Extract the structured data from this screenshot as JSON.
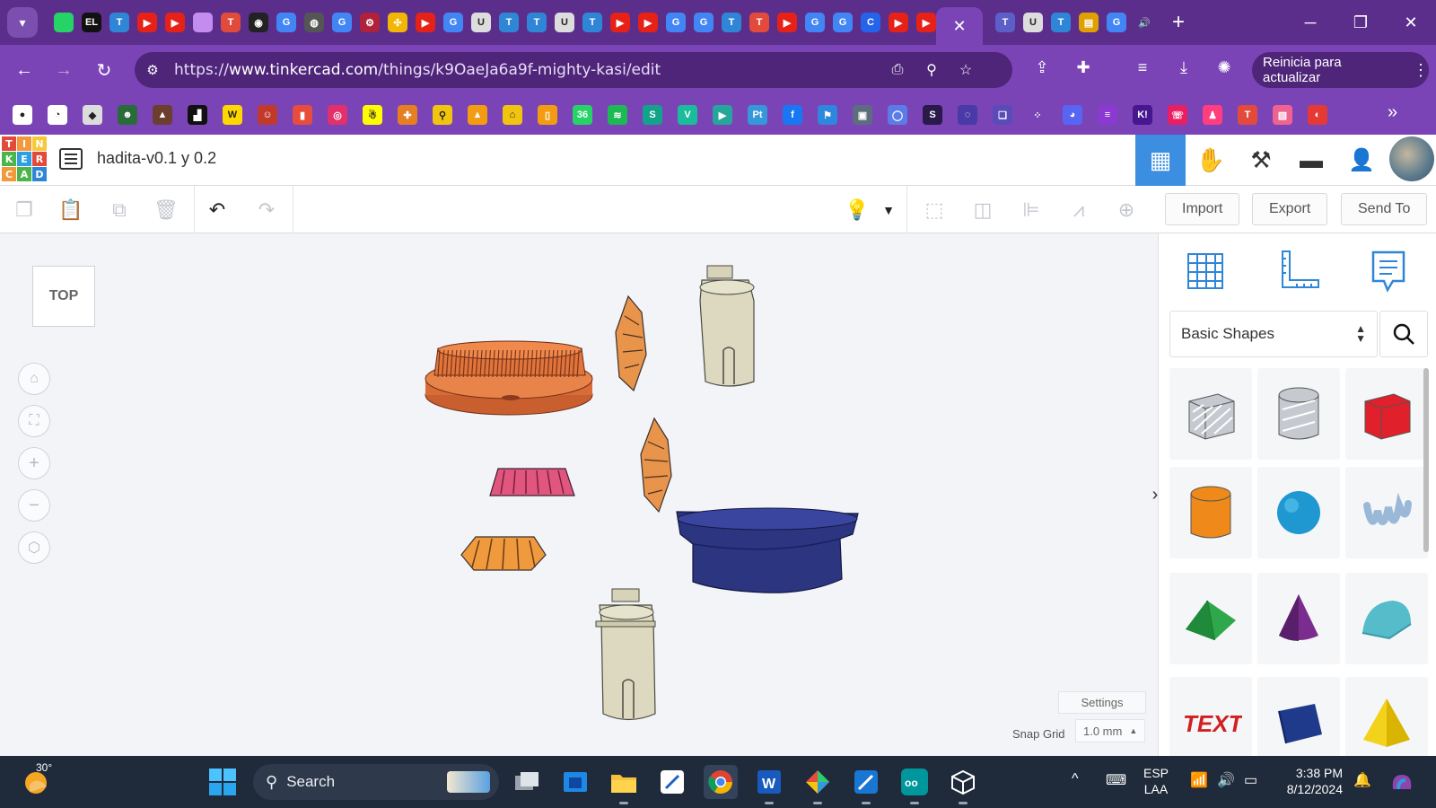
{
  "browser": {
    "tab_strip": {
      "badge_count": "36",
      "close_glyph": "✕",
      "new_tab_glyph": "+",
      "tab_favicons": [
        {
          "icon": "whatsapp-icon",
          "color": "#25d366",
          "text": ""
        },
        {
          "icon": "el-icon",
          "color": "#111111",
          "text": "EL"
        },
        {
          "icon": "teams-t-icon",
          "color": "#2f86d6",
          "text": "T"
        },
        {
          "icon": "youtube-icon",
          "color": "#e62117",
          "text": "▶"
        },
        {
          "icon": "youtube-icon",
          "color": "#e62117",
          "text": "▶"
        },
        {
          "icon": "lilac-square-icon",
          "color": "#c58cf0",
          "text": ""
        },
        {
          "icon": "tinkercad-icon",
          "color": "#e24a3b",
          "text": "T"
        },
        {
          "icon": "github-icon",
          "color": "#222222",
          "text": "◉"
        },
        {
          "icon": "google-icon",
          "color": "#4285f4",
          "text": "G"
        },
        {
          "icon": "globe-icon",
          "color": "#555555",
          "text": "◍"
        },
        {
          "icon": "google-icon",
          "color": "#4285f4",
          "text": "G"
        },
        {
          "icon": "gear-red-icon",
          "color": "#b0213a",
          "text": "⚙"
        },
        {
          "icon": "pinwheel-icon",
          "color": "#f2b705",
          "text": "✣"
        },
        {
          "icon": "youtube-icon",
          "color": "#e62117",
          "text": "▶"
        },
        {
          "icon": "google-icon",
          "color": "#4285f4",
          "text": "G"
        },
        {
          "icon": "u-icon",
          "color": "#dddddd",
          "text": "U"
        },
        {
          "icon": "teams-t-icon",
          "color": "#2f86d6",
          "text": "T"
        },
        {
          "icon": "teams-t-icon",
          "color": "#2f86d6",
          "text": "T"
        },
        {
          "icon": "u-icon",
          "color": "#dddddd",
          "text": "U"
        },
        {
          "icon": "teams-t-icon",
          "color": "#2f86d6",
          "text": "T"
        },
        {
          "icon": "youtube-icon",
          "color": "#e62117",
          "text": "▶"
        },
        {
          "icon": "youtube-icon",
          "color": "#e62117",
          "text": "▶"
        },
        {
          "icon": "google-icon",
          "color": "#4285f4",
          "text": "G"
        },
        {
          "icon": "google-icon",
          "color": "#4285f4",
          "text": "G"
        },
        {
          "icon": "teams-t-icon",
          "color": "#2f86d6",
          "text": "T"
        },
        {
          "icon": "tinkercad-icon",
          "color": "#e24a3b",
          "text": "T"
        },
        {
          "icon": "youtube-icon",
          "color": "#e62117",
          "text": "▶"
        },
        {
          "icon": "google-icon",
          "color": "#4285f4",
          "text": "G"
        },
        {
          "icon": "google-icon",
          "color": "#4285f4",
          "text": "G"
        },
        {
          "icon": "copilot-c-icon",
          "color": "#2563eb",
          "text": "C"
        },
        {
          "icon": "youtube-icon",
          "color": "#e62117",
          "text": "▶"
        },
        {
          "icon": "youtube-icon",
          "color": "#e62117",
          "text": "▶"
        }
      ],
      "tab_favicons_after_active": [
        {
          "icon": "teams-icon",
          "color": "#5b5fc7",
          "text": "T"
        },
        {
          "icon": "u-icon",
          "color": "#dddddd",
          "text": "U"
        },
        {
          "icon": "teams-t-icon",
          "color": "#2f86d6",
          "text": "T"
        },
        {
          "icon": "tv-icon",
          "color": "#e0a100",
          "text": "▤"
        },
        {
          "icon": "google-icon",
          "color": "#4285f4",
          "text": "G"
        },
        {
          "icon": "speaker-icon",
          "color": "#5b2e8c",
          "text": "🔊"
        }
      ]
    },
    "url": {
      "prefix": "https://",
      "host": "www.tinkercad.com",
      "path": "/things/k9OaeJa6a9f-mighty-kasi/edit"
    },
    "relaunch_label": "Reinicia para actualizar",
    "bookmarks": [
      {
        "icon": "chrome-app-icon",
        "color": "#ffffff",
        "text": "●"
      },
      {
        "icon": "clock-icon",
        "color": "#ffffff",
        "text": "◔"
      },
      {
        "icon": "cube-icon",
        "color": "#dcdcdc",
        "text": "◆"
      },
      {
        "icon": "robot-icon",
        "color": "#2a6b3a",
        "text": "☻"
      },
      {
        "icon": "animal-icon",
        "color": "#6b3e2e",
        "text": "▲"
      },
      {
        "icon": "tools-icon",
        "color": "#111111",
        "text": "▟"
      },
      {
        "icon": "wikipedia-icon",
        "color": "#ffd700",
        "text": "W"
      },
      {
        "icon": "avatar-icon",
        "color": "#c0392b",
        "text": "☺"
      },
      {
        "icon": "red-app-icon",
        "color": "#e74c3c",
        "text": "▮"
      },
      {
        "icon": "instagram-icon",
        "color": "#e1306c",
        "text": "◎"
      },
      {
        "icon": "snapchat-icon",
        "color": "#fffc00",
        "text": "☃"
      },
      {
        "icon": "puzzle-icon",
        "color": "#e67e22",
        "text": "✚"
      },
      {
        "icon": "magnifier-icon",
        "color": "#f1c40f",
        "text": "⚲"
      },
      {
        "icon": "cone-icon",
        "color": "#f39c12",
        "text": "▲"
      },
      {
        "icon": "home-icon",
        "color": "#f1c40f",
        "text": "⌂"
      },
      {
        "icon": "bookmark-app-icon",
        "color": "#f39c12",
        "text": "▯"
      },
      {
        "icon": "whatsapp-icon",
        "color": "#25d366",
        "text": "36"
      },
      {
        "icon": "spotify-icon",
        "color": "#1db954",
        "text": "≋"
      },
      {
        "icon": "skype-icon",
        "color": "#13a38b",
        "text": "S"
      },
      {
        "icon": "vector-icon",
        "color": "#1abc9c",
        "text": "V"
      },
      {
        "icon": "play-icon",
        "color": "#26a69a",
        "text": "▶"
      },
      {
        "icon": "pt-icon",
        "color": "#3498db",
        "text": "Pt"
      },
      {
        "icon": "facebook-icon",
        "color": "#1877f2",
        "text": "f"
      },
      {
        "icon": "flag-icon",
        "color": "#2e86de",
        "text": "⚑"
      },
      {
        "icon": "photo-icon",
        "color": "#5d6d7e",
        "text": "▣"
      },
      {
        "icon": "loop-icon",
        "color": "#5b7ce8",
        "text": "◯"
      },
      {
        "icon": "s-purple-icon",
        "color": "#2a1a4a",
        "text": "S"
      },
      {
        "icon": "swirl-icon",
        "color": "#4a3aa8",
        "text": "◌"
      },
      {
        "icon": "layers-icon",
        "color": "#5b4bb8",
        "text": "❏"
      },
      {
        "icon": "dots-circle-icon",
        "color": "#7a44b6",
        "text": "⁘"
      },
      {
        "icon": "discord-icon",
        "color": "#5865f2",
        "text": "◕"
      },
      {
        "icon": "stripes-icon",
        "color": "#8a3ad0",
        "text": "≡"
      },
      {
        "icon": "kahoot-icon",
        "color": "#46178f",
        "text": "K!"
      },
      {
        "icon": "phone-icon",
        "color": "#e91e63",
        "text": "☏"
      },
      {
        "icon": "drop-icon",
        "color": "#ff3d7f",
        "text": "♟"
      },
      {
        "icon": "tinkercad-icon",
        "color": "#e24a3b",
        "text": "T"
      },
      {
        "icon": "gradient-square-icon",
        "color": "#f06292",
        "text": "▧"
      },
      {
        "icon": "panda-icon",
        "color": "#e53935",
        "text": "◐"
      }
    ],
    "bookmarks_more": "»"
  },
  "tinkercad": {
    "logo_letters": [
      "T",
      "I",
      "N",
      "K",
      "E",
      "R",
      "C",
      "A",
      "D"
    ],
    "logo_colors": [
      "#e24a3b",
      "#f29a3b",
      "#f8c83a",
      "#4bb54a",
      "#2f9fe2",
      "#e24a3b",
      "#f29a3b",
      "#4bb54a",
      "#2f86d6"
    ],
    "project_title": "hadita-v0.1 y 0.2",
    "toolbar": {
      "import_label": "Import",
      "export_label": "Export",
      "send_to_label": "Send To"
    },
    "canvas": {
      "viewcube_label": "TOP",
      "settings_label": "Settings",
      "snap_grid_label": "Snap Grid",
      "snap_grid_value": "1.0 mm",
      "object_colors": {
        "orange_gear": "#e8844a",
        "pink_gear": "#e0567f",
        "beige_shaft": "#dcd9c0",
        "navy_base": "#2b3580"
      }
    },
    "shape_panel": {
      "library_label": "Basic Shapes",
      "shapes": [
        {
          "name": "box-hole",
          "color": "#c6cad0"
        },
        {
          "name": "cylinder-hole",
          "color": "#c6cad0"
        },
        {
          "name": "box",
          "color": "#e0202a"
        },
        {
          "name": "cylinder",
          "color": "#ef8a1a"
        },
        {
          "name": "sphere",
          "color": "#1f97d0"
        },
        {
          "name": "scribble",
          "color": "#9ab8d8"
        },
        {
          "name": "roof",
          "color": "#2ea84a"
        },
        {
          "name": "cone",
          "color": "#7b2d8f"
        },
        {
          "name": "round-roof",
          "color": "#56bcc9"
        },
        {
          "name": "text",
          "color": "#d02020"
        },
        {
          "name": "polygon",
          "color": "#1f3a8a"
        },
        {
          "name": "pyramid",
          "color": "#f3d21b"
        }
      ]
    }
  },
  "taskbar": {
    "temperature": "30°",
    "search_placeholder": "Search",
    "language_line1": "ESP",
    "language_line2": "LAA",
    "time": "3:38 PM",
    "date": "8/12/2024"
  }
}
